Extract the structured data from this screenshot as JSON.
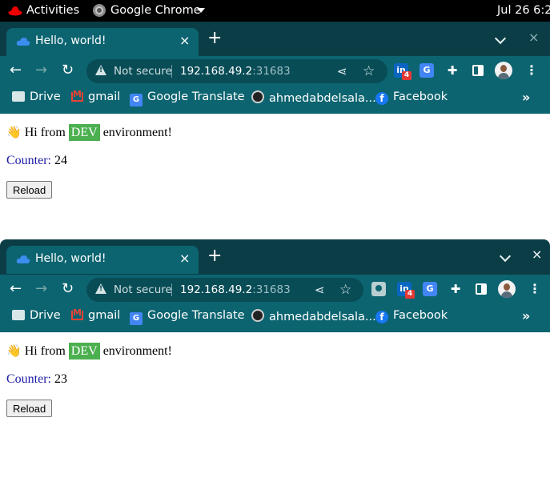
{
  "topbar": {
    "activities": "Activities",
    "app_name": "Google Chrome",
    "clock": "Jul 26  6:2"
  },
  "windows": [
    {
      "tab": {
        "title": "Hello, world!",
        "close": "×"
      },
      "new_tab": "+",
      "window_close": "×",
      "omnibox": {
        "security": "Not secure",
        "host": "192.168.49.2",
        "port": ":31683"
      },
      "extensions": {
        "linkedin_badge": "4"
      },
      "bookmarks": [
        "Drive",
        "gmail",
        "Google Translate",
        "ahmedabdelsala...",
        "Facebook"
      ],
      "page": {
        "wave": "👋",
        "hi_from": "Hi from",
        "env": "DEV",
        "environment_suffix": "environment!",
        "counter_label": "Counter:",
        "counter_value": "24",
        "reload_button": "Reload"
      }
    },
    {
      "tab": {
        "title": "Hello, world!",
        "close": "×"
      },
      "new_tab": "+",
      "window_close": "×",
      "omnibox": {
        "security": "Not secure",
        "host": "192.168.49.2",
        "port": ":31683"
      },
      "extensions": {
        "linkedin_badge": "4"
      },
      "bookmarks": [
        "Drive",
        "gmail",
        "Google Translate",
        "ahmedabdelsala...",
        "Facebook"
      ],
      "page": {
        "wave": "👋",
        "hi_from": "Hi from",
        "env": "DEV",
        "environment_suffix": "environment!",
        "counter_label": "Counter:",
        "counter_value": "23",
        "reload_button": "Reload"
      }
    }
  ],
  "colors": {
    "tabstrip": "#0b3d46",
    "toolbar": "#0c6470",
    "omnibox": "#084c56",
    "env_badge": "#4caf50",
    "counter_label": "#1a1aa6"
  }
}
